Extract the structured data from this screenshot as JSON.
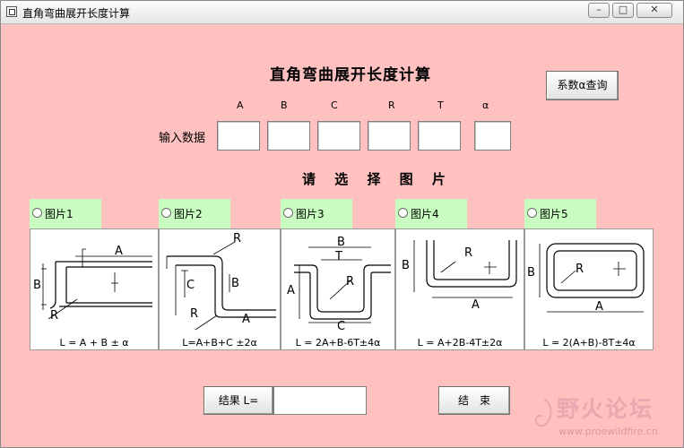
{
  "window": {
    "title": "直角弯曲展开长度计算",
    "controls": {
      "minimize": "–",
      "maximize": "□",
      "close": "✕"
    }
  },
  "main_title": "直角弯曲展开长度计算",
  "coef_button": "系数α查询",
  "input_label": "输入数据",
  "columns": [
    "A",
    "B",
    "C",
    "R",
    "T",
    "α"
  ],
  "inputs": {
    "A": "",
    "B": "",
    "C": "",
    "R": "",
    "T": "",
    "alpha": ""
  },
  "select_title": "请 选 择 图 片",
  "options": [
    {
      "label": "图片1",
      "formula": "L = A + B ± α"
    },
    {
      "label": "图片2",
      "formula": "L=A+B+C ±2α"
    },
    {
      "label": "图片3",
      "formula": "L = 2A+B-6T±4α"
    },
    {
      "label": "图片4",
      "formula": "L = A+2B-4T±2α"
    },
    {
      "label": "图片5",
      "formula": "L = 2(A+B)-8T±4α"
    }
  ],
  "figure_labels": {
    "A": "A",
    "B": "B",
    "C": "C",
    "R": "R",
    "T": "T"
  },
  "result_label": "结果 L=",
  "result_value": "",
  "end_button": "结　束",
  "watermark": {
    "text": "野火论坛",
    "url": "www.proewildfire.cn"
  }
}
